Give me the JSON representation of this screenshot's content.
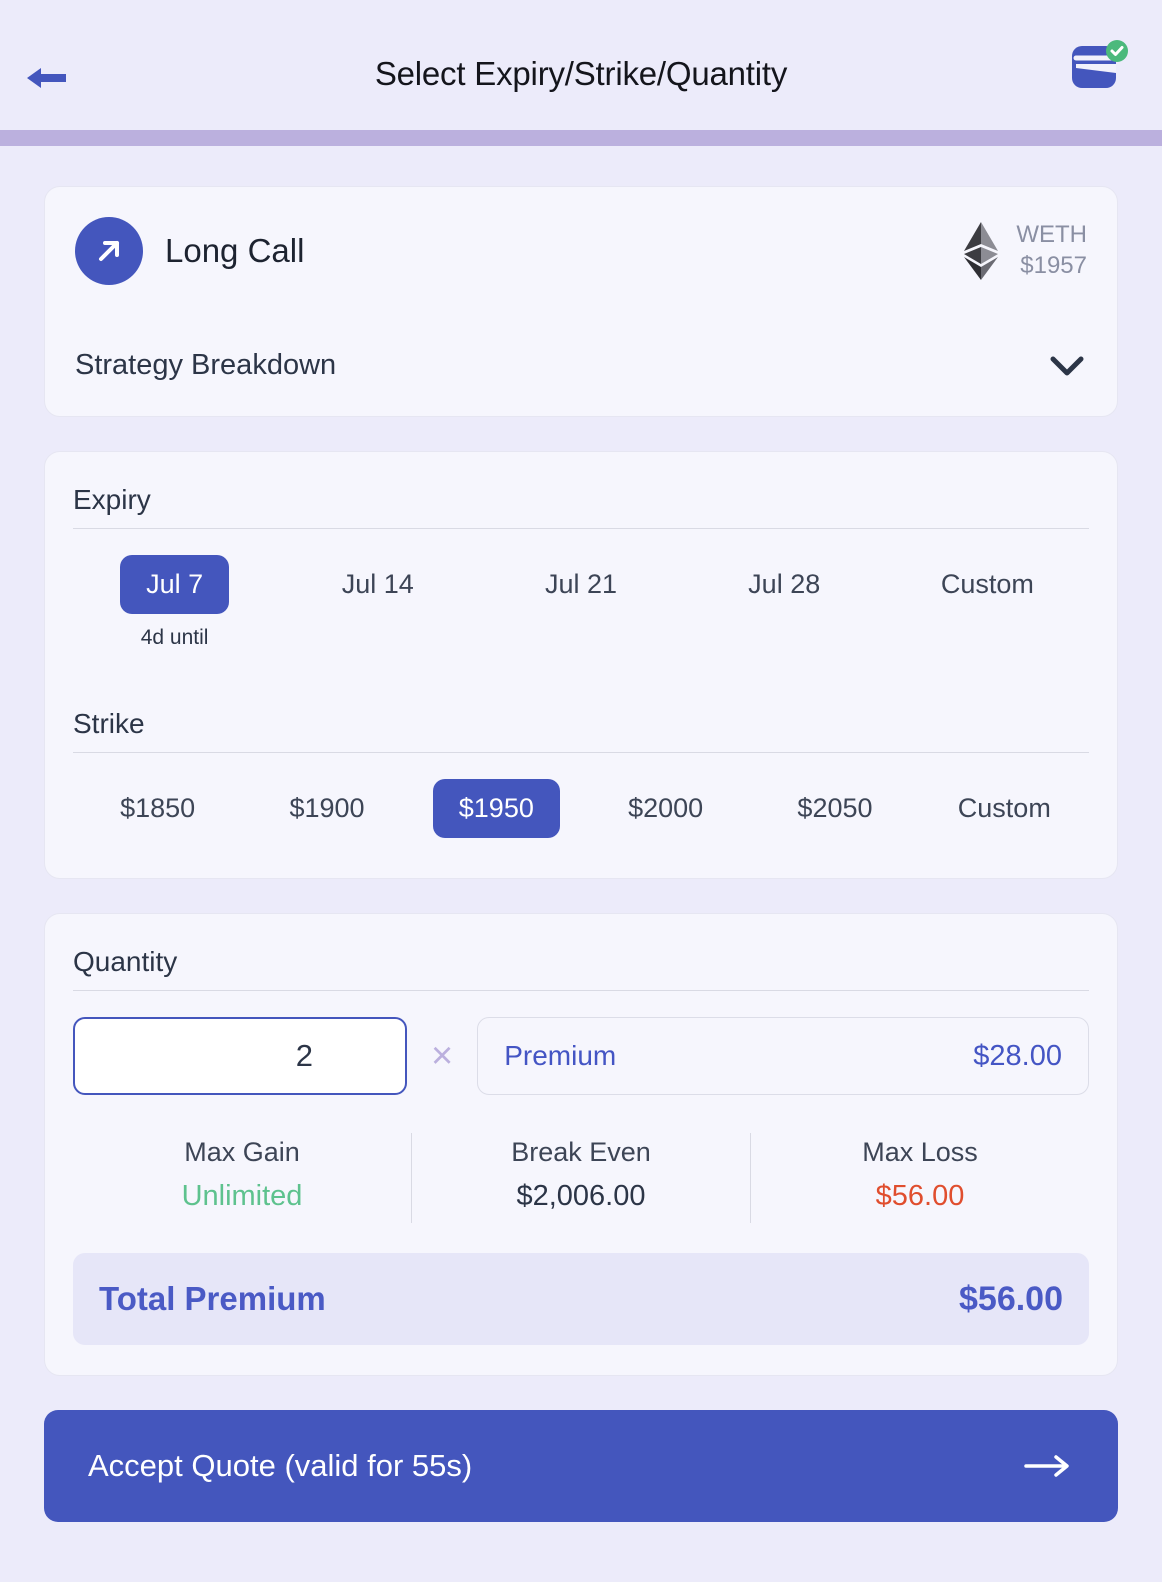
{
  "header": {
    "title": "Select Expiry/Strike/Quantity",
    "back_icon": "arrow-left-icon",
    "wallet_icon": "wallet-connected-icon"
  },
  "strategy": {
    "icon": "arrow-up-right-icon",
    "name": "Long Call",
    "asset_icon": "ethereum-icon",
    "asset_symbol": "WETH",
    "asset_price": "$1957",
    "breakdown_label": "Strategy Breakdown",
    "breakdown_chevron": "chevron-down-icon"
  },
  "expiry": {
    "label": "Expiry",
    "options": [
      {
        "label": "Jul 7",
        "sub": "4d until",
        "selected": true
      },
      {
        "label": "Jul 14",
        "sub": "",
        "selected": false
      },
      {
        "label": "Jul 21",
        "sub": "",
        "selected": false
      },
      {
        "label": "Jul 28",
        "sub": "",
        "selected": false
      },
      {
        "label": "Custom",
        "sub": "",
        "selected": false
      }
    ]
  },
  "strike": {
    "label": "Strike",
    "options": [
      {
        "label": "$1850",
        "selected": false
      },
      {
        "label": "$1900",
        "selected": false
      },
      {
        "label": "$1950",
        "selected": true
      },
      {
        "label": "$2000",
        "selected": false
      },
      {
        "label": "$2050",
        "selected": false
      },
      {
        "label": "Custom",
        "selected": false
      }
    ]
  },
  "quantity": {
    "label": "Quantity",
    "value": "2",
    "placeholder": "1",
    "multiply_symbol": "×",
    "premium_label": "Premium",
    "premium_value": "$28.00"
  },
  "metrics": [
    {
      "label": "Max Gain",
      "value": "Unlimited",
      "tone": "positive"
    },
    {
      "label": "Break Even",
      "value": "$2,006.00",
      "tone": "neutral"
    },
    {
      "label": "Max Loss",
      "value": "$56.00",
      "tone": "negative"
    }
  ],
  "total": {
    "label": "Total Premium",
    "value": "$56.00"
  },
  "accept": {
    "label": "Accept Quote (valid for 55s)",
    "arrow_icon": "arrow-right-icon"
  },
  "colors": {
    "accent": "#4456bd",
    "page_bg": "#ecebfa",
    "card_bg": "#f6f6fd",
    "progress": "#bbb0de",
    "positive": "#5ec28e",
    "negative": "#e04e2e",
    "total_bg": "#e6e6f8",
    "total_text": "#4a5ac5"
  }
}
